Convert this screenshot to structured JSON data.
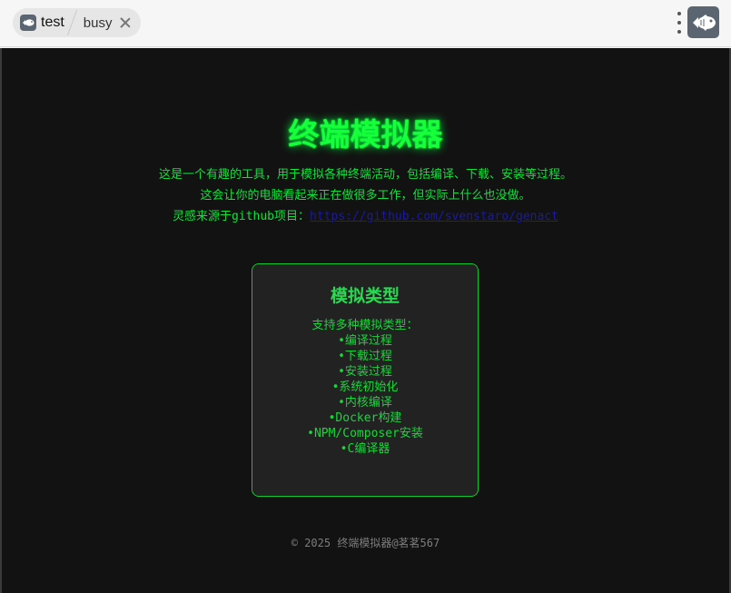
{
  "browser": {
    "tab_title": "test",
    "tab_status": "busy",
    "icons": {
      "tab_icon": "fish-icon",
      "close": "close-icon",
      "menu": "more-vertical-icon",
      "app_logo": "fish-icon"
    }
  },
  "page": {
    "title": "终端模拟器",
    "intro_line1": "这是一个有趣的工具，用于模拟各种终端活动，包括编译、下载、安装等过程。",
    "intro_line2": "这会让你的电脑看起来正在做很多工作，但实际上什么也没做。",
    "intro_line3_prefix": "灵感来源于github项目：",
    "intro_link": "https://github.com/svenstaro/genact",
    "card": {
      "title": "模拟类型",
      "lead": "支持多种模拟类型：",
      "items": [
        "编译过程",
        "下载过程",
        "安装过程",
        "系统初始化",
        "内核编译",
        "Docker构建",
        "NPM/Composer安装",
        "C编译器"
      ]
    },
    "footer": "© 2025 终端模拟器@茗茗567"
  },
  "colors": {
    "background": "#121212",
    "accent_green": "#17ff3a",
    "card_background": "#222222",
    "card_border": "#10c830",
    "link": "#1a1aa6",
    "footer_text": "#7d7d7d"
  }
}
